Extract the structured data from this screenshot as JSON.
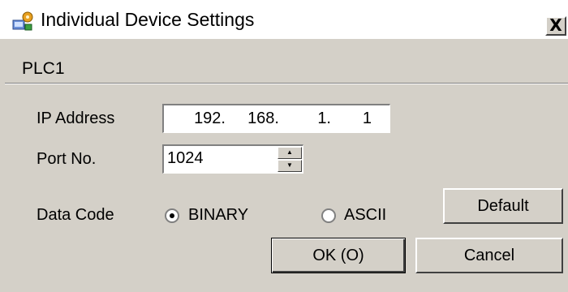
{
  "window": {
    "title": "Individual Device Settings",
    "close_glyph": "X",
    "icon": "device-settings-icon"
  },
  "device": {
    "name": "PLC1"
  },
  "ip": {
    "label": "IP Address",
    "octets": [
      "192.",
      "168.",
      "1.",
      "1"
    ]
  },
  "port": {
    "label": "Port No.",
    "value": "1024",
    "up_glyph": "▲",
    "down_glyph": "▼"
  },
  "data_code": {
    "label": "Data Code",
    "options": [
      "BINARY",
      "ASCII"
    ],
    "selected": "BINARY"
  },
  "buttons": {
    "default": "Default",
    "ok": "OK (O)",
    "cancel": "Cancel"
  }
}
